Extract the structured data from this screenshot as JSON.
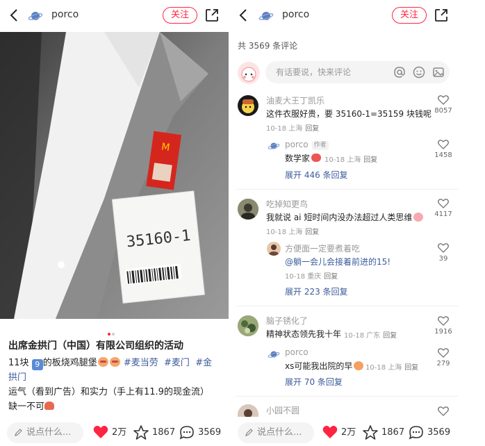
{
  "header": {
    "author": "porco",
    "follow_label": "关注"
  },
  "post": {
    "title": "出席金拱门（中国）有限公司组织的活动",
    "line1_pre": "11块",
    "line1_num": "9",
    "line1_mid": "的板烧鸡腿堡",
    "tags": [
      "#麦当劳",
      "#麦门",
      "#金"
    ],
    "tag_cont": "拱门",
    "line3": "运气（看到广告）和实力（手上有11.9的现金流）",
    "line4": "缺一不可",
    "badge_text": "35160-1"
  },
  "bottom": {
    "input_placeholder": "说点什么...",
    "likes": "2万",
    "favorites": "1867",
    "comments": "3569"
  },
  "comments_panel": {
    "count_text": "共 3569 条评论",
    "say_placeholder": "有话要说，快来评论",
    "comments": [
      {
        "name": "油麦大王丁凯乐",
        "text": "这件衣服好贵，要 35160-1=35159 块钱呢",
        "date": "10-18",
        "location": "上海",
        "reply": "回复",
        "likes": "8057",
        "sub": {
          "name": "porco",
          "author_tag": "作者",
          "text": "数学家",
          "date": "10-18",
          "location": "上海",
          "reply": "回复",
          "likes": "1458"
        },
        "expand": "展开 446 条回复"
      },
      {
        "name": "吃掉知更鸟",
        "text": "我就说 ai 短时间内没办法超过人类思维",
        "date": "10-18",
        "location": "上海",
        "reply": "回复",
        "likes": "4117",
        "sub": {
          "name": "方便面一定要煮着吃",
          "text": "@躺一会儿会接着前进的15!",
          "date": "10-18",
          "location": "重庆",
          "reply": "回复",
          "likes": "39"
        },
        "expand": "展开 223 条回复"
      },
      {
        "name": "脑子锈化了",
        "text": "精神状态领先我十年",
        "date": "10-18",
        "location": "广东",
        "reply": "回复",
        "likes": "1916",
        "sub": {
          "name": "porco",
          "text": "xs可能我出院的早",
          "date": "10-18",
          "location": "上海",
          "reply": "回复",
          "likes": "279"
        },
        "expand": "展开 70 条回复"
      },
      {
        "name": "小园不圆"
      }
    ]
  },
  "colors": {
    "accent": "#ff2442",
    "link": "#3c5b9b"
  },
  "icons": [
    "back-arrow-icon",
    "planet-avatar-icon",
    "share-icon",
    "pen-icon",
    "heart-icon",
    "star-icon",
    "comment-bubble-icon",
    "at-icon",
    "smile-icon",
    "image-icon"
  ]
}
